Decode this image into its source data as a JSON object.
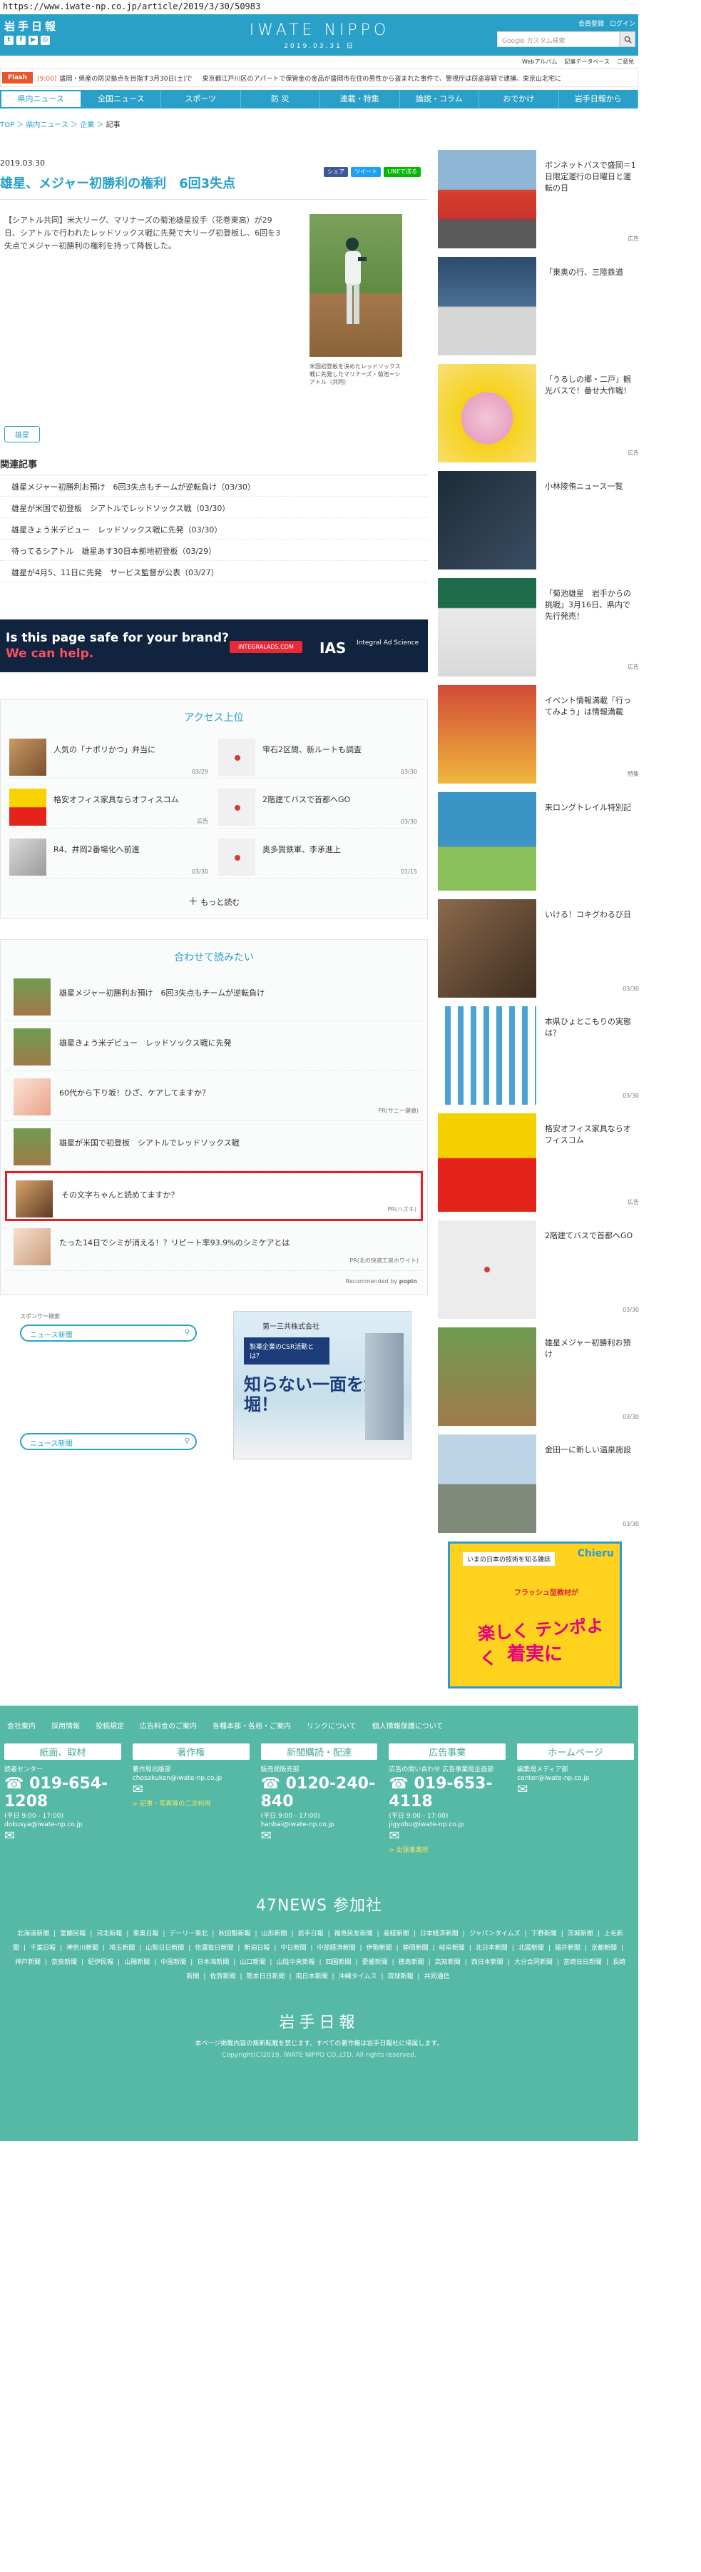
{
  "url": "https://www.iwate-np.co.jp/article/2019/3/30/50983",
  "header": {
    "logo": "岩手日報",
    "brand": "IWATE NIPPO",
    "date": "2019.03.31 日",
    "links": [
      "会員登録",
      "ログイン"
    ],
    "search_placeholder": "Google カスタム検索",
    "sublinks": [
      "Webアルバム",
      "記事データベース",
      "ご意見"
    ]
  },
  "flash": {
    "label": "Flash",
    "items": [
      {
        "time": "[9:00]",
        "text": "盛岡・県産の防災拠点を目指す3月30日(土)で"
      },
      {
        "time": "",
        "text": "東京都江戸川区のアパートで保管金の金品が盛岡市在住の男性から盗まれた事件で、警視庁は窃盗容疑で逮捕、東京山北宅に"
      }
    ]
  },
  "nav": [
    "県内ニュース",
    "全国ニュース",
    "スポーツ",
    "防 災",
    "連載・特集",
    "論説・コラム",
    "おでかけ",
    "岩手日報から"
  ],
  "breadcrumb": [
    "TOP",
    "県内ニュース",
    "企業",
    "記事"
  ],
  "article": {
    "date": "2019.03.30",
    "share": [
      "シェア",
      "ツイート",
      "LINEで送る"
    ],
    "title": "雄星、メジャー初勝利の権利　6回3失点",
    "body": "【シアトル共同】米大リーグ、マリナーズの菊池雄星投手（花巻東高）が29日、シアトルで行われたレッドソックス戦に先発で大リーグ初登板し、6回を3失点でメジャー初勝利の権利を持って降板した。",
    "caption": "米国初登板を決めたレッドソックス戦に先発したマリナーズ・菊池＝シアトル（共同）",
    "tag": "雄星"
  },
  "related": {
    "heading": "関連記事",
    "items": [
      "雄星メジャー初勝利お預け　6回3失点もチームが逆転負け（03/30）",
      "雄星が米国で初登板　シアトルでレッドソックス戦（03/30）",
      "雄星きょう米デビュー　レッドソックス戦に先発（03/30）",
      "待ってるシアトル　雄星あす30日本拠地初登板（03/29）",
      "雄星が4月5、11日に先発　サービス監督が公表（03/27）"
    ]
  },
  "banner": {
    "line1": "Is this page safe for your brand?",
    "line2": "We can help.",
    "pill": "INTEGRALADS.COM",
    "logo": "IAS",
    "logo_sub": "Integral Ad Science"
  },
  "access": {
    "heading": "アクセス上位",
    "items": [
      {
        "title": "人気の「ナポリかつ」弁当に",
        "date": "03/29"
      },
      {
        "title": "雫石2区間、新ルートも調査",
        "date": "03/30"
      },
      {
        "title": "格安オフィス家具ならオフィスコム",
        "date": "広告"
      },
      {
        "title": "2階建てバスで首都へGO",
        "date": "03/30"
      },
      {
        "title": "R4、井岡2番場化へ前進",
        "date": "03/30"
      },
      {
        "title": "奥多賀鉄軍、李承進上",
        "date": "01/15"
      }
    ],
    "more": "もっと読む"
  },
  "recommend": {
    "heading": "合わせて読みたい",
    "items": [
      {
        "title": "雄星メジャー初勝利お預け　6回3失点もチームが逆転負け",
        "date": ""
      },
      {
        "title": "雄星きょう米デビュー　レッドソックス戦に先発",
        "date": ""
      },
      {
        "title": "60代から下り坂！ひざ、ケアしてますか？",
        "date": "PR(サニー健康)"
      },
      {
        "title": "雄星が米国で初登板　シアトルでレッドソックス戦",
        "date": ""
      },
      {
        "title": "その文字ちゃんと読めてますか？",
        "date": "PR(ハズキ)"
      },
      {
        "title": "たった14日でシミが消える！？リピート率93.9%のシミケアとは",
        "date": "PR(北の快適工房ホワイト)"
      }
    ],
    "powered": "Recommended by"
  },
  "sponsor": {
    "label": "スポンサー検索",
    "search1": "ニュース新聞",
    "search2": "ニュース新聞",
    "ad_company": "第一三共株式会社",
    "ad_head": "製薬企業のCSR活動とは？",
    "ad_big": "知らない一面を深堀！"
  },
  "sidebar": [
    {
      "title": "ボンネットバスで盛岡＝1日限定運行の日曜日と運転の日",
      "date": "広告"
    },
    {
      "title": "「東奥の行、三陸鉄道",
      "date": ""
    },
    {
      "title": "「うるしの郷・二戸」観光バスで！番せ大作戦！",
      "date": "広告"
    },
    {
      "title": "小林陵侑ニュース一覧",
      "date": ""
    },
    {
      "title": "「菊池雄星　岩手からの挑戦」3月16日、県内で先行発売！",
      "date": "広告"
    },
    {
      "title": "イベント情報満載「行ってみよう」は情報満載",
      "date": "特集"
    },
    {
      "title": "来ロングトレイル特別記",
      "date": ""
    },
    {
      "title": "いける！コキグわるび日",
      "date": "03/30"
    },
    {
      "title": "本県ひょとこもりの実態は？",
      "date": "03/30"
    },
    {
      "title": "格安オフィス家具ならオフィスコム",
      "date": "広告"
    },
    {
      "title": "2階建てバスで首都へGO",
      "date": "03/30"
    },
    {
      "title": "雄星メジャー初勝利お預け",
      "date": "03/30"
    },
    {
      "title": "金田一に新しい温泉施設",
      "date": "03/30"
    }
  ],
  "side_ad": {
    "top": "いまの日本の技術を知る雑誌",
    "brand": "Chieru",
    "mid": "フラッシュ型教材が",
    "big1": "楽しく テンポよく",
    "big2": "着実に"
  },
  "footer": {
    "links": [
      "会社案内",
      "採用情報",
      "投稿規定",
      "広告料金のご案内",
      "各種本部・各局・ご案内",
      "リンクについて",
      "個人情報保護について"
    ],
    "cols": [
      {
        "head": "紙面、取材",
        "sub": "読者センター",
        "tel": "019-654-1208",
        "hours": "(平日 9:00 - 17:00)",
        "mail": "dokusya@iwate-np.co.jp",
        "link": ""
      },
      {
        "head": "著作権",
        "sub": "著作局出版部",
        "tel": "",
        "hours": "",
        "mail": "chosakuken@iwate-np.co.jp",
        "link": "> 記事・写真等の二次利用"
      },
      {
        "head": "新聞購読・配達",
        "sub": "販売局販売部",
        "tel": "0120-240-840",
        "hours": "(平日 9:00 - 17:00)",
        "mail": "hanbai@iwate-np.co.jp",
        "link": ""
      },
      {
        "head": "広告事業",
        "sub": "広告の問い合わせ 広告事業局企画部",
        "tel": "019-653-4118",
        "hours": "(平日 9:00 - 17:00)",
        "mail": "jigyobu@iwate-np.co.jp",
        "link": "> 出張事業所"
      },
      {
        "head": "ホームページ",
        "sub": "編集局メディア部",
        "tel": "",
        "hours": "",
        "mail": "center@iwate-np.co.jp",
        "link": ""
      }
    ],
    "news_heading": "47NEWS 参加社",
    "news_list": [
      "北海道新聞",
      "室蘭民報",
      "河北新報",
      "東奥日報",
      "デーリー東北",
      "秋田魁新報",
      "山形新聞",
      "岩手日報",
      "福島民友新聞",
      "産経新聞",
      "日本経済新聞",
      "ジャパンタイムズ",
      "下野新聞",
      "茨城新聞",
      "上毛新聞",
      "千葉日報",
      "神奈川新聞",
      "埼玉新聞",
      "山梨日日新聞",
      "信濃毎日新聞",
      "新潟日報",
      "中日新聞",
      "中部経済新聞",
      "伊勢新聞",
      "静岡新聞",
      "岐阜新聞",
      "北日本新聞",
      "北國新聞",
      "福井新聞",
      "京都新聞",
      "神戸新聞",
      "奈良新聞",
      "紀伊民報",
      "山陽新聞",
      "中国新聞",
      "日本海新聞",
      "山口新聞",
      "山陰中央新報",
      "四国新聞",
      "愛媛新聞",
      "徳島新聞",
      "高知新聞",
      "西日本新聞",
      "大分合同新聞",
      "宮崎日日新聞",
      "長崎新聞",
      "佐賀新聞",
      "熊本日日新聞",
      "南日本新聞",
      "沖縄タイムス",
      "琉球新報",
      "共同通信"
    ],
    "logo": "岩手日報",
    "note": "本ページ掲載内容の無断転載を禁じます。すべての著作権は岩手日報社に帰属します。",
    "copy": "Copyright(C)2019, IWATE NIPPO CO.,LTD. All rights reserved."
  }
}
